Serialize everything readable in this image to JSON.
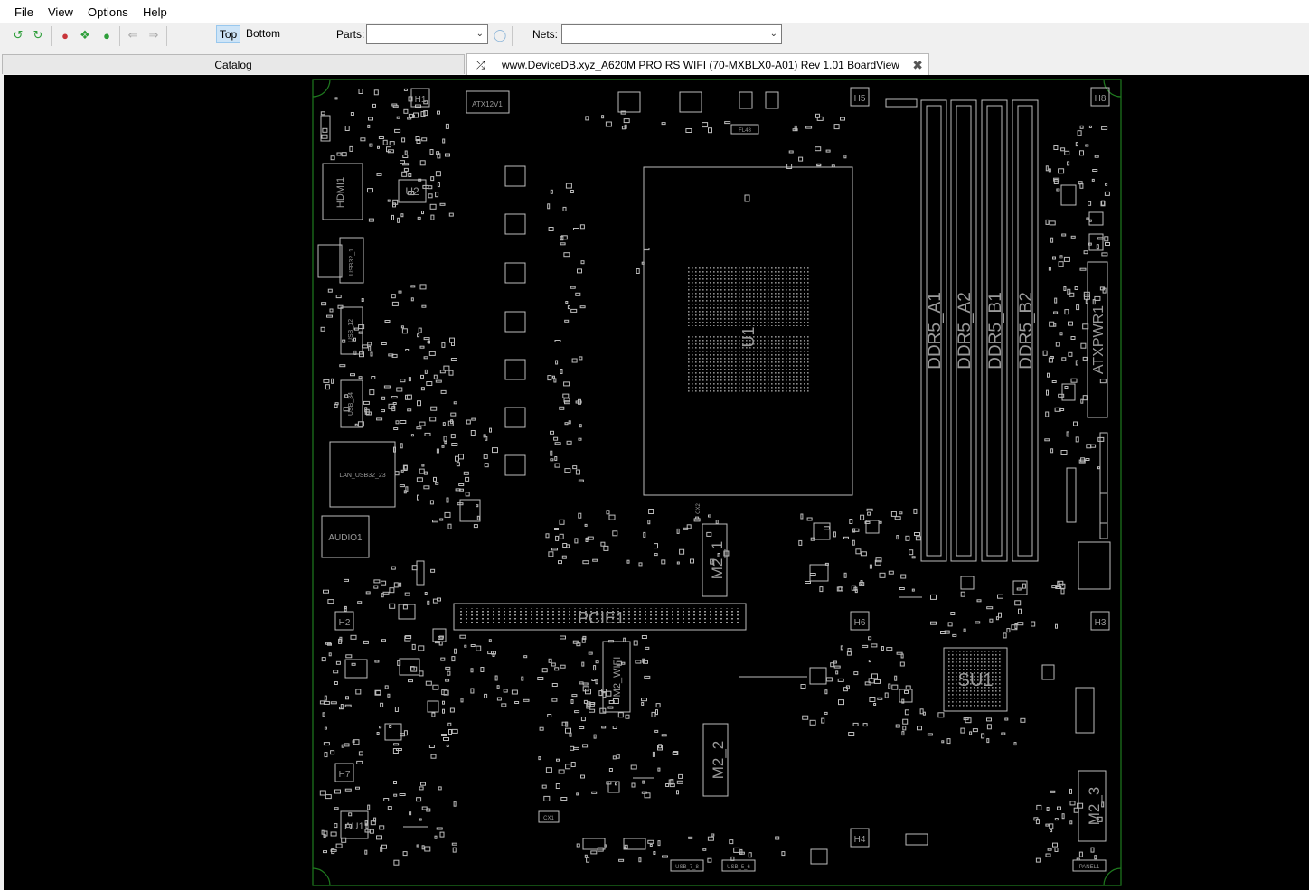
{
  "menu": {
    "file": "File",
    "view": "View",
    "options": "Options",
    "help": "Help"
  },
  "toolbar": {
    "icons": [
      "rotate-left-icon",
      "rotate-right-icon",
      "zoom-out-icon",
      "zoom-fit-icon",
      "zoom-in-icon",
      "back-arrow-icon",
      "forward-arrow-icon"
    ],
    "top_label": "Top",
    "bottom_label": "Bottom",
    "parts_label": "Parts:",
    "parts_value": "",
    "nets_label": "Nets:",
    "nets_value": ""
  },
  "tabs": {
    "catalog": "Catalog",
    "board": "www.DeviceDB.xyz_A620M PRO RS WIFI (70-MXBLX0-A01) Rev 1.01 BoardView"
  },
  "board": {
    "colors": {
      "background": "#000000",
      "outline": "#1f7a1f",
      "component": "#bdbdbd",
      "label": "#9a9a9a"
    },
    "labels": {
      "u1": "U1",
      "u2": "U2",
      "su1": "SU1",
      "pcie1": "PCIE1",
      "m2_1": "M2_1",
      "m2_2": "M2_2",
      "m2_3": "M2_3",
      "m2_wifi": "M2_WIFI",
      "ddr5_a1": "DDR5_A1",
      "ddr5_a2": "DDR5_A2",
      "ddr5_b1": "DDR5_B1",
      "ddr5_b2": "DDR5_B2",
      "atxpwr1": "ATXPWR1",
      "atx12v1": "ATX12V1",
      "hdmi1": "HDMI1",
      "audio1": "AUDIO1",
      "au1": "AU1",
      "lan": "LAN_USB32_23",
      "usb32_1": "USB32_1",
      "usb_12": "USB_12",
      "usb_34": "USB_34",
      "usb_56": "USB_5_6",
      "usb_78": "USB_7_8",
      "panel1": "PANEL1",
      "h1": "H1",
      "h2": "H2",
      "h3": "H3",
      "h4": "H4",
      "h5": "H5",
      "h6": "H6",
      "h7": "H7",
      "h8": "H8",
      "fl48": "FL48",
      "cx1": "CX1",
      "cx2": "CX2"
    }
  }
}
